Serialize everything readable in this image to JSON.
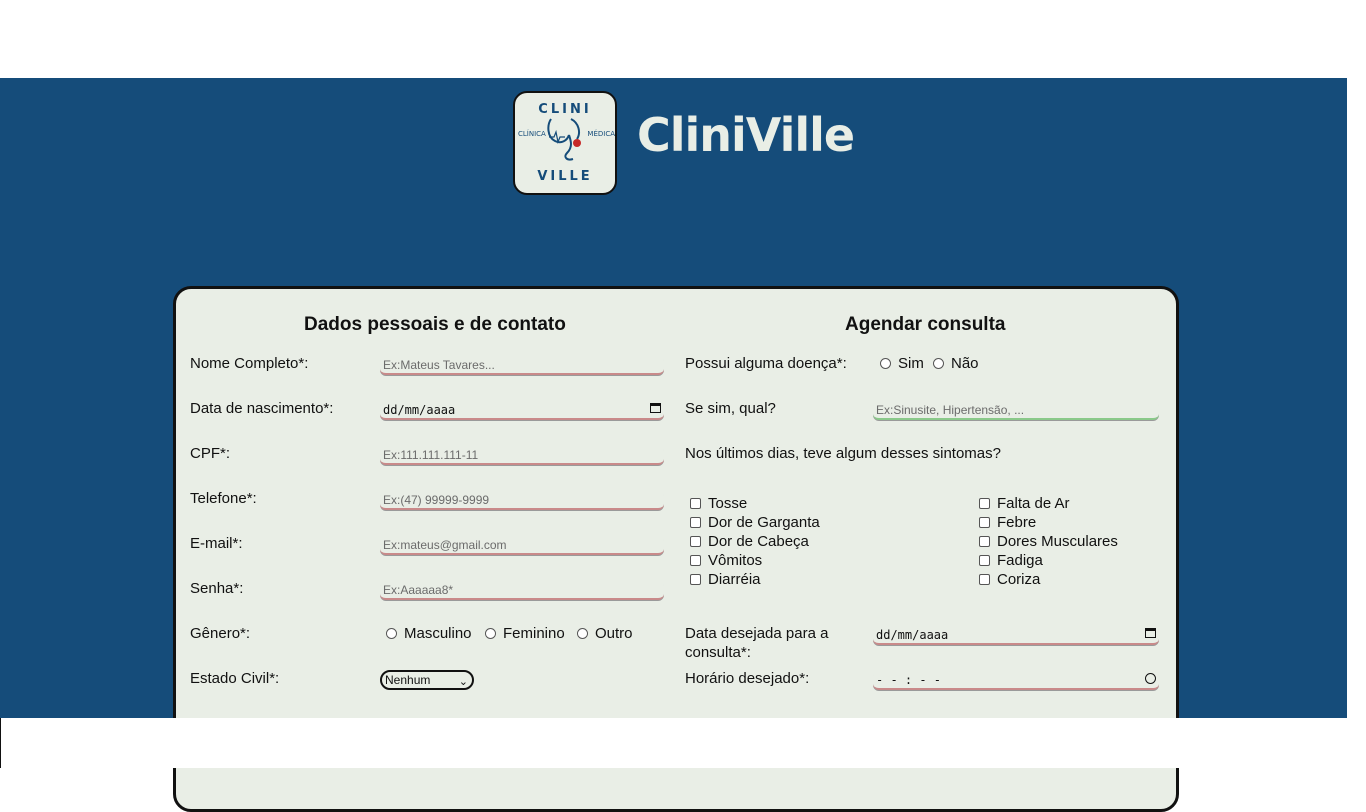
{
  "brand": {
    "logo_top": "CLINI",
    "logo_bottom": "VILLE",
    "logo_left": "CLÍNICA",
    "logo_right": "MÉDICA",
    "name": "CliniVille"
  },
  "personal": {
    "heading": "Dados pessoais e de contato",
    "name_label": "Nome Completo*:",
    "name_placeholder": "Ex:Mateus Tavares...",
    "birth_label": "Data de nascimento*:",
    "birth_value": "dd/mm/aaaa",
    "cpf_label": "CPF*:",
    "cpf_placeholder": "Ex:111.111.111-11",
    "phone_label": "Telefone*:",
    "phone_placeholder": "Ex:(47) 99999-9999",
    "email_label": "E-mail*:",
    "email_placeholder": "Ex:mateus@gmail.com",
    "password_label": "Senha*:",
    "password_placeholder": "Ex:Aaaaaa8*",
    "gender_label": "Gênero*:",
    "gender_options": [
      "Masculino",
      "Feminino",
      "Outro"
    ],
    "civil_label": "Estado Civil*:",
    "civil_value": "Nenhum"
  },
  "appointment": {
    "heading": "Agendar consulta",
    "disease_label": "Possui alguma doença*:",
    "disease_options": [
      "Sim",
      "Não"
    ],
    "which_label": "Se sim, qual?",
    "which_placeholder": "Ex:Sinusite, Hipertensão, ...",
    "symptoms_label": "Nos últimos dias, teve algum desses sintomas?",
    "symptoms_left": [
      "Tosse",
      "Dor de Garganta",
      "Dor de Cabeça",
      "Vômitos",
      "Diarréia"
    ],
    "symptoms_right": [
      "Falta de Ar",
      "Febre",
      "Dores Musculares",
      "Fadiga",
      "Coriza"
    ],
    "date_label_1": "Data desejada para a",
    "date_label_2": "consulta*:",
    "date_value": "dd/mm/aaaa",
    "time_label": "Horário desejado*:",
    "time_value": "- - : - -"
  },
  "colors": {
    "header_bg": "#154c7a",
    "card_bg": "#e9eee6",
    "input_underline": "#c98a8a",
    "accent_green": "#8ac98a"
  }
}
